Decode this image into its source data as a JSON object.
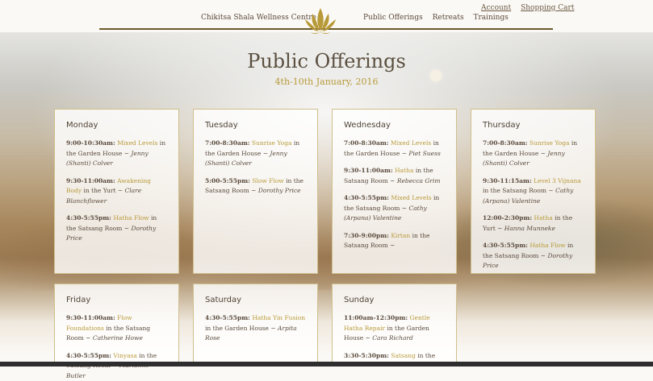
{
  "header": {
    "account_label": "Account",
    "cart_label": "Shopping Cart",
    "site_name": "Chikitsa Shala Wellness Centre",
    "nav": [
      "Public Offerings",
      "Retreats",
      "Trainings"
    ]
  },
  "page": {
    "title": "Public Offerings",
    "subtitle": "4th-10th January, 2016"
  },
  "days": [
    {
      "name": "Monday",
      "entries": [
        {
          "time": "9:00-10:30am:",
          "cls": "Mixed Levels",
          "mid": " in the Garden House ~ ",
          "teacher": "Jenny (Shanti) Colver"
        },
        {
          "time": "9:30-11:00am:",
          "cls": "Awakening Body",
          "mid": " in the Yurt ~ ",
          "teacher": "Clare Blanchflower"
        },
        {
          "time": "4:30-5:55pm:",
          "cls": "Hatha Flow",
          "mid": " in the Satsang Room ~ ",
          "teacher": "Dorothy Price"
        }
      ]
    },
    {
      "name": "Tuesday",
      "entries": [
        {
          "time": "7:00-8:30am:",
          "cls": "Sunrise Yoga",
          "mid": " in the Garden House ~ ",
          "teacher": "Jenny (Shanti) Colver"
        },
        {
          "time": "5:00-5:55pm:",
          "cls": "Slow Flow",
          "mid": " in the Satsang Room ~ ",
          "teacher": "Dorothy Price"
        }
      ]
    },
    {
      "name": "Wednesday",
      "entries": [
        {
          "time": "7:00-8:30am:",
          "cls": "Mixed Levels",
          "mid": " in the Garden House ~ ",
          "teacher": "Piet Suess"
        },
        {
          "time": "9:30-11:00am:",
          "cls": "Hatha",
          "mid": " in the Satsang Room ~ ",
          "teacher": "Rebecca Grim"
        },
        {
          "time": "4:30-5:55pm:",
          "cls": "Mixed Levels",
          "mid": " in the Satsang Room ~ ",
          "teacher": "Cathy (Arpana) Valentine"
        },
        {
          "time": "7:30-9:00pm:",
          "cls": "Kirtan",
          "mid": " in the Satsang Room ~",
          "teacher": ""
        }
      ]
    },
    {
      "name": "Thursday",
      "entries": [
        {
          "time": "7:00-8:30am:",
          "cls": "Sunrise Yoga",
          "mid": " in the Garden House ~ ",
          "teacher": "Jenny (Shanti) Colver"
        },
        {
          "time": "9:30-11:15am:",
          "cls": "Level 3 Vijnana",
          "mid": " in the Satsang Room ~ ",
          "teacher": "Cathy (Arpana) Valentine"
        },
        {
          "time": "12:00-2:30pm:",
          "cls": "Hatha",
          "mid": " in the Yurt ~ ",
          "teacher": "Hanna Munneke"
        },
        {
          "time": "4:30-5:55pm:",
          "cls": "Hatha Flow",
          "mid": " in the Satsang Room ~ ",
          "teacher": "Dorothy Price"
        }
      ]
    },
    {
      "name": "Friday",
      "entries": [
        {
          "time": "9:30-11:00am:",
          "cls": "Flow Foundations",
          "mid": " in the Satsang Room ~ ",
          "teacher": "Catherine Howe"
        },
        {
          "time": "4:30-5:55pm:",
          "cls": "Vinyasa",
          "mid": " in the Satsang Room ~ ",
          "teacher": "Marianne Butler"
        }
      ]
    },
    {
      "name": "Saturday",
      "entries": [
        {
          "time": "4:30-5:55pm:",
          "cls": "Hatha Yin Fusion",
          "mid": " in the Garden House ~ ",
          "teacher": "Arpita Rose"
        }
      ]
    },
    {
      "name": "Sunday",
      "entries": [
        {
          "time": "11:00am-12:30pm:",
          "cls": "Gentle Hatha Repair",
          "mid": " in the Garden House ~ ",
          "teacher": "Cara Richard"
        },
        {
          "time": "3:30-5:30pm:",
          "cls": "Satsang",
          "mid": " in the",
          "teacher": ""
        }
      ]
    }
  ],
  "colors": {
    "accent": "#b89a3a",
    "text": "#5a4a3c",
    "border": "#cfbf8c"
  },
  "icons": {
    "logo": "lotus-logo-icon"
  }
}
